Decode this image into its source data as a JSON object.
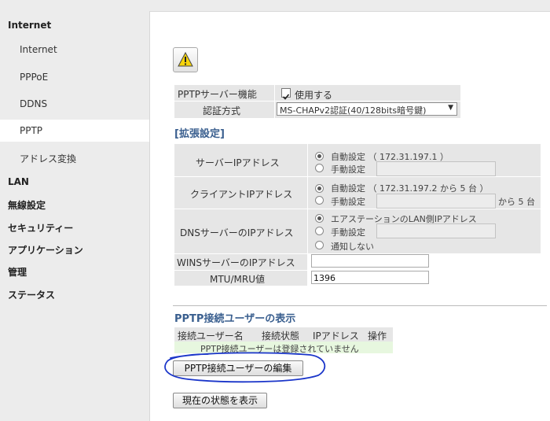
{
  "sidebar": {
    "groups": [
      {
        "label": "Internet"
      },
      {
        "label": "LAN"
      },
      {
        "label": "無線設定"
      },
      {
        "label": "セキュリティー"
      },
      {
        "label": "アプリケーション"
      },
      {
        "label": "管理"
      },
      {
        "label": "ステータス"
      }
    ],
    "items": [
      {
        "label": "Internet"
      },
      {
        "label": "PPPoE"
      },
      {
        "label": "DDNS"
      },
      {
        "label": "PPTP"
      },
      {
        "label": "アドレス変換"
      }
    ]
  },
  "pptp": {
    "server_label": "PPTPサーバー機能",
    "use_label": "使用する",
    "use_checked": true,
    "auth_label": "認証方式",
    "auth_value": "MS-CHAPv2認証(40/128bits暗号鍵)"
  },
  "extended": {
    "title": "[拡張設定]",
    "server_ip": {
      "label": "サーバーIPアドレス",
      "auto": "自動設定 （ 172.31.197.1 ）",
      "manual": "手動設定",
      "selected": "auto"
    },
    "client_ip": {
      "label": "クライアントIPアドレス",
      "auto": "自動設定 （ 172.31.197.2 から 5 台 ）",
      "manual": "手動設定",
      "suffix": "から 5 台",
      "selected": "auto"
    },
    "dns_ip": {
      "label": "DNSサーバーのIPアドレス",
      "opt1": "エアステーションのLAN側IPアドレス",
      "opt2": "手動設定",
      "opt3": "通知しない",
      "selected": "opt1"
    },
    "wins": {
      "label": "WINSサーバーのIPアドレス",
      "value": ""
    },
    "mtu": {
      "label": "MTU/MRU値",
      "value": "1396"
    }
  },
  "users": {
    "title": "PPTP接続ユーザーの表示",
    "columns": [
      "接続ユーザー名",
      "接続状態",
      "IPアドレス",
      "操作"
    ],
    "empty_message": "PPTP接続ユーザーは登録されていません",
    "edit_button": "PPTP接続ユーザーの編集"
  },
  "status_button": "現在の状態を表示",
  "colors": {
    "highlight_circle": "#1a35c9",
    "section_title": "#3a5f8f"
  }
}
